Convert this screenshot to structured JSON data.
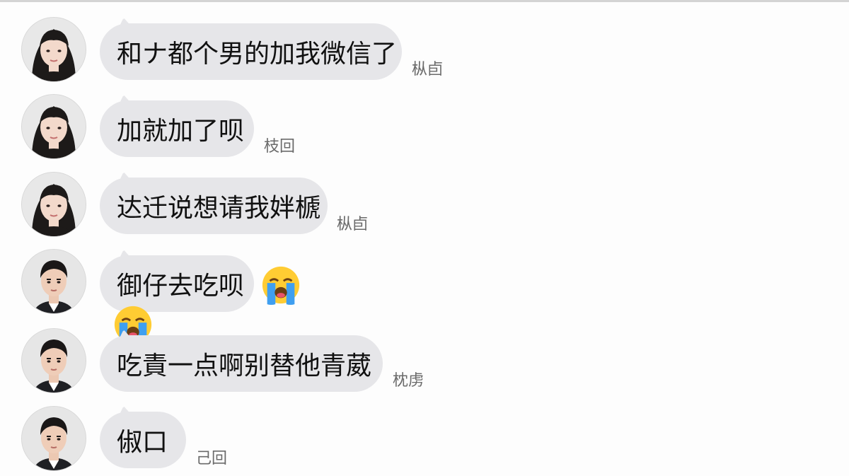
{
  "messages": [
    {
      "text": "和ナ都个男的加我微信了",
      "receipt": "枞卣",
      "sender": "female"
    },
    {
      "text": "加就加了呗",
      "receipt": "枝回",
      "sender": "female"
    },
    {
      "text": "达迁说想请我姅榹",
      "receipt": "枞卣",
      "sender": "female"
    },
    {
      "text": "御仔去吃呗",
      "receipt": "",
      "sender": "male"
    },
    {
      "text": "吃責一点啊别替他青葳",
      "receipt": "枕虏",
      "sender": "male"
    },
    {
      "text": "俶口",
      "receipt": "己回",
      "sender": "male"
    }
  ],
  "emojis": [
    "loudly-crying-face",
    "loudly-crying-face"
  ],
  "colors": {
    "bubble": "#e6e6e9",
    "text": "#111111",
    "receipt": "#6a6a6a",
    "background": "#fdfdfd",
    "emoji_face": "#ffcc33",
    "emoji_tears": "#3f9ff0"
  }
}
